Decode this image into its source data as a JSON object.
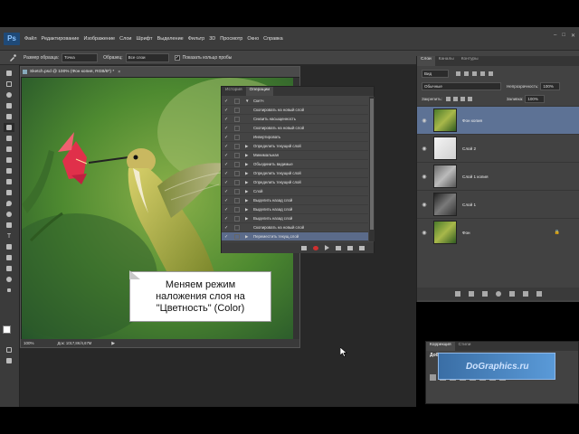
{
  "app": {
    "logo": "Ps",
    "accent": "#5d7295",
    "workspace_bg": "#282828",
    "panel_bg": "#424242",
    "record_color": "#d03030"
  },
  "menu": {
    "items": [
      "Файл",
      "Редактирование",
      "Изображение",
      "Слои",
      "Шрифт",
      "Выделение",
      "Фильтр",
      "3D",
      "Просмотр",
      "Окно",
      "Справка"
    ],
    "window_controls": [
      "–",
      "□",
      "✕"
    ]
  },
  "options": {
    "size_label": "Размер образца:",
    "size_value": "Точка",
    "sample_label": "Образец:",
    "sample_value": "Все слои",
    "show_ring_label": "Показать кольцо пробы"
  },
  "document": {
    "tab_label": "Sketch.psd @ 100% (Фон копия, RGB/8*) *",
    "close": "×",
    "zoom": "100%",
    "info": "Док: 1017,8K/4,67M"
  },
  "actions_panel": {
    "tabs": [
      "История",
      "Операции"
    ],
    "rows": [
      {
        "check": "✓",
        "tri": "▼",
        "label": "Скетч",
        "selected": false
      },
      {
        "check": "✓",
        "tri": "",
        "label": "Скопировать на новый слой",
        "selected": false
      },
      {
        "check": "✓",
        "tri": "",
        "label": "Снизить насыщенность",
        "selected": false
      },
      {
        "check": "✓",
        "tri": "",
        "label": "Скопировать на новый слой",
        "selected": false
      },
      {
        "check": "✓",
        "tri": "",
        "label": "Инвертировать",
        "selected": false
      },
      {
        "check": "✓",
        "tri": "▶",
        "label": "Определить текущий слой",
        "selected": false
      },
      {
        "check": "✓",
        "tri": "▶",
        "label": "Минимальная",
        "selected": false
      },
      {
        "check": "✓",
        "tri": "▶",
        "label": "Объединить видимые",
        "selected": false
      },
      {
        "check": "✓",
        "tri": "▶",
        "label": "Определить текущий слой",
        "selected": false
      },
      {
        "check": "✓",
        "tri": "▶",
        "label": "Определить текущий слой",
        "selected": false
      },
      {
        "check": "✓",
        "tri": "▶",
        "label": "Слой",
        "selected": false
      },
      {
        "check": "✓",
        "tri": "▶",
        "label": "Выделить назад слой",
        "selected": false
      },
      {
        "check": "✓",
        "tri": "▶",
        "label": "Выделить назад слой",
        "selected": false
      },
      {
        "check": "✓",
        "tri": "▶",
        "label": "Выделить назад слой",
        "selected": false
      },
      {
        "check": "✓",
        "tri": "",
        "label": "Скопировать на новый слой",
        "selected": false
      },
      {
        "check": "✓",
        "tri": "▶",
        "label": "Переместить текущ.слой",
        "selected": true
      }
    ]
  },
  "callout": {
    "text": "Меняем режим\nналожения слоя на\n\"Цветность\" (Color)"
  },
  "layers_panel": {
    "tabs": [
      "Слои",
      "Каналы",
      "Контуры"
    ],
    "filter_value": "Вид",
    "blend_value": "Обычные",
    "opacity_label": "Непрозрачность:",
    "opacity_value": "100%",
    "lock_label": "Закрепить:",
    "fill_label": "Заливка:",
    "fill_value": "100%",
    "layers": [
      {
        "name": "Фон копия",
        "selected": true,
        "thumb": "color",
        "lock": ""
      },
      {
        "name": "Слой 2",
        "selected": false,
        "thumb": "sketch",
        "lock": ""
      },
      {
        "name": "Слой 1 копия",
        "selected": false,
        "thumb": "gray",
        "lock": ""
      },
      {
        "name": "Слой 1",
        "selected": false,
        "thumb": "dark",
        "lock": ""
      },
      {
        "name": "Фон",
        "selected": false,
        "thumb": "color",
        "lock": "🔒"
      }
    ]
  },
  "correction_panel": {
    "tabs": [
      "Коррекция",
      "Стили"
    ],
    "add_label": "Доба",
    "watermark": "DoGraphics.ru"
  }
}
